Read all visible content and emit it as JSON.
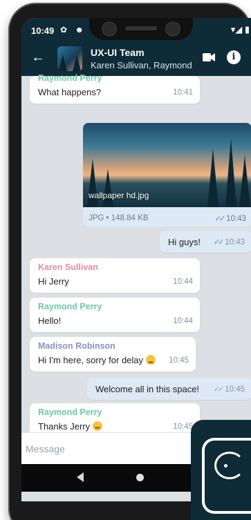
{
  "status_bar": {
    "time": "10:49",
    "left_icons": "✿ ☻ •",
    "right_icons": "▾◢ ▮"
  },
  "chat": {
    "title": "UX-UI Team",
    "subtitle": "Karen Sullivan, Raymond"
  },
  "colors": {
    "header_bg": "#0f2b38",
    "raymond": "#6cc9a4",
    "karen": "#e38ba9",
    "madison": "#8e8ec3",
    "read_ticks": "#4a8fd8"
  },
  "messages": [
    {
      "sender": "Raymond Perry",
      "text": "What happens?",
      "time": "10:41",
      "direction": "in"
    },
    {
      "type": "image",
      "caption": "wallpaper hd.jpg",
      "file_info": "JPG • 148.84 KB",
      "time": "10:43",
      "ticks": "✓✓",
      "direction": "out"
    },
    {
      "text": "Hi guys!",
      "time": "10:43",
      "ticks": "✓✓",
      "direction": "out"
    },
    {
      "sender": "Karen Sullivan",
      "text": "Hi Jerry",
      "time": "10:44",
      "direction": "in"
    },
    {
      "sender": "Raymond Perry",
      "text": "Hello!",
      "time": "10:44",
      "direction": "in"
    },
    {
      "sender": "Madison Robinson",
      "text": "Hi  I'm here, sorry for delay",
      "time": "10:45",
      "direction": "in",
      "emoji": "sad-face"
    },
    {
      "text": "Welcome all in this space!",
      "time": "10:45",
      "ticks": "✓✓",
      "direction": "out"
    },
    {
      "sender": "Raymond Perry",
      "text": "Thanks Jerry",
      "time": "10:45",
      "direction": "in",
      "emoji": "smile-face"
    }
  ],
  "input": {
    "placeholder": "Message"
  },
  "icons": [
    "back-arrow-icon",
    "video-camera-icon",
    "info-icon",
    "read-receipt-icon",
    "nav-back-icon",
    "nav-home-icon",
    "nav-recent-icon",
    "app-logo-icon"
  ]
}
